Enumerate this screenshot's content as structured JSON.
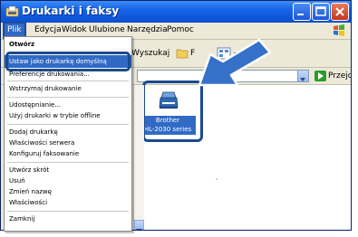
{
  "window": {
    "title": "Drukarki i faksy"
  },
  "menubar": {
    "items": [
      {
        "label": "Plik"
      },
      {
        "label": "Edycja"
      },
      {
        "label": "Widok"
      },
      {
        "label": "Ulubione"
      },
      {
        "label": "Narzędzia"
      },
      {
        "label": "Pomoc"
      }
    ]
  },
  "toolbar": {
    "search_label": "Wyszukaj",
    "folders_label": "F"
  },
  "addressbar": {
    "go_label": "Przejdź"
  },
  "content": {
    "printer": {
      "label_line1": "Brother",
      "label_line2": "HL-2030 series"
    }
  },
  "dropdown": {
    "items": [
      {
        "label": "Otwórz"
      },
      {
        "label": "Ustaw jako drukarkę domyślną"
      },
      {
        "label": "Preferencje drukowania..."
      },
      {
        "label": "Wstrzymaj drukowanie"
      },
      {
        "label": "Udostępnianie..."
      },
      {
        "label": "Użyj drukarki w trybie offline"
      },
      {
        "label": "Dodaj drukarkę"
      },
      {
        "label": "Właściwości serwera"
      },
      {
        "label": "Konfiguruj faksowanie"
      },
      {
        "label": "Utwórz skrót"
      },
      {
        "label": "Usuń"
      },
      {
        "label": "Zmień nazwę"
      },
      {
        "label": "Właściwości"
      },
      {
        "label": "Zamknij"
      }
    ]
  },
  "colors": {
    "titlebar": "#0a4fd2",
    "selection": "#316ac5",
    "highlight_frame": "#1b4a8f"
  },
  "icons": {
    "title": "printer-folder-icon",
    "search": "search-icon",
    "folders": "folder-icon",
    "views": "views-icon",
    "printer": "printer-icon",
    "annotation": "pointer-arrow-icon"
  }
}
